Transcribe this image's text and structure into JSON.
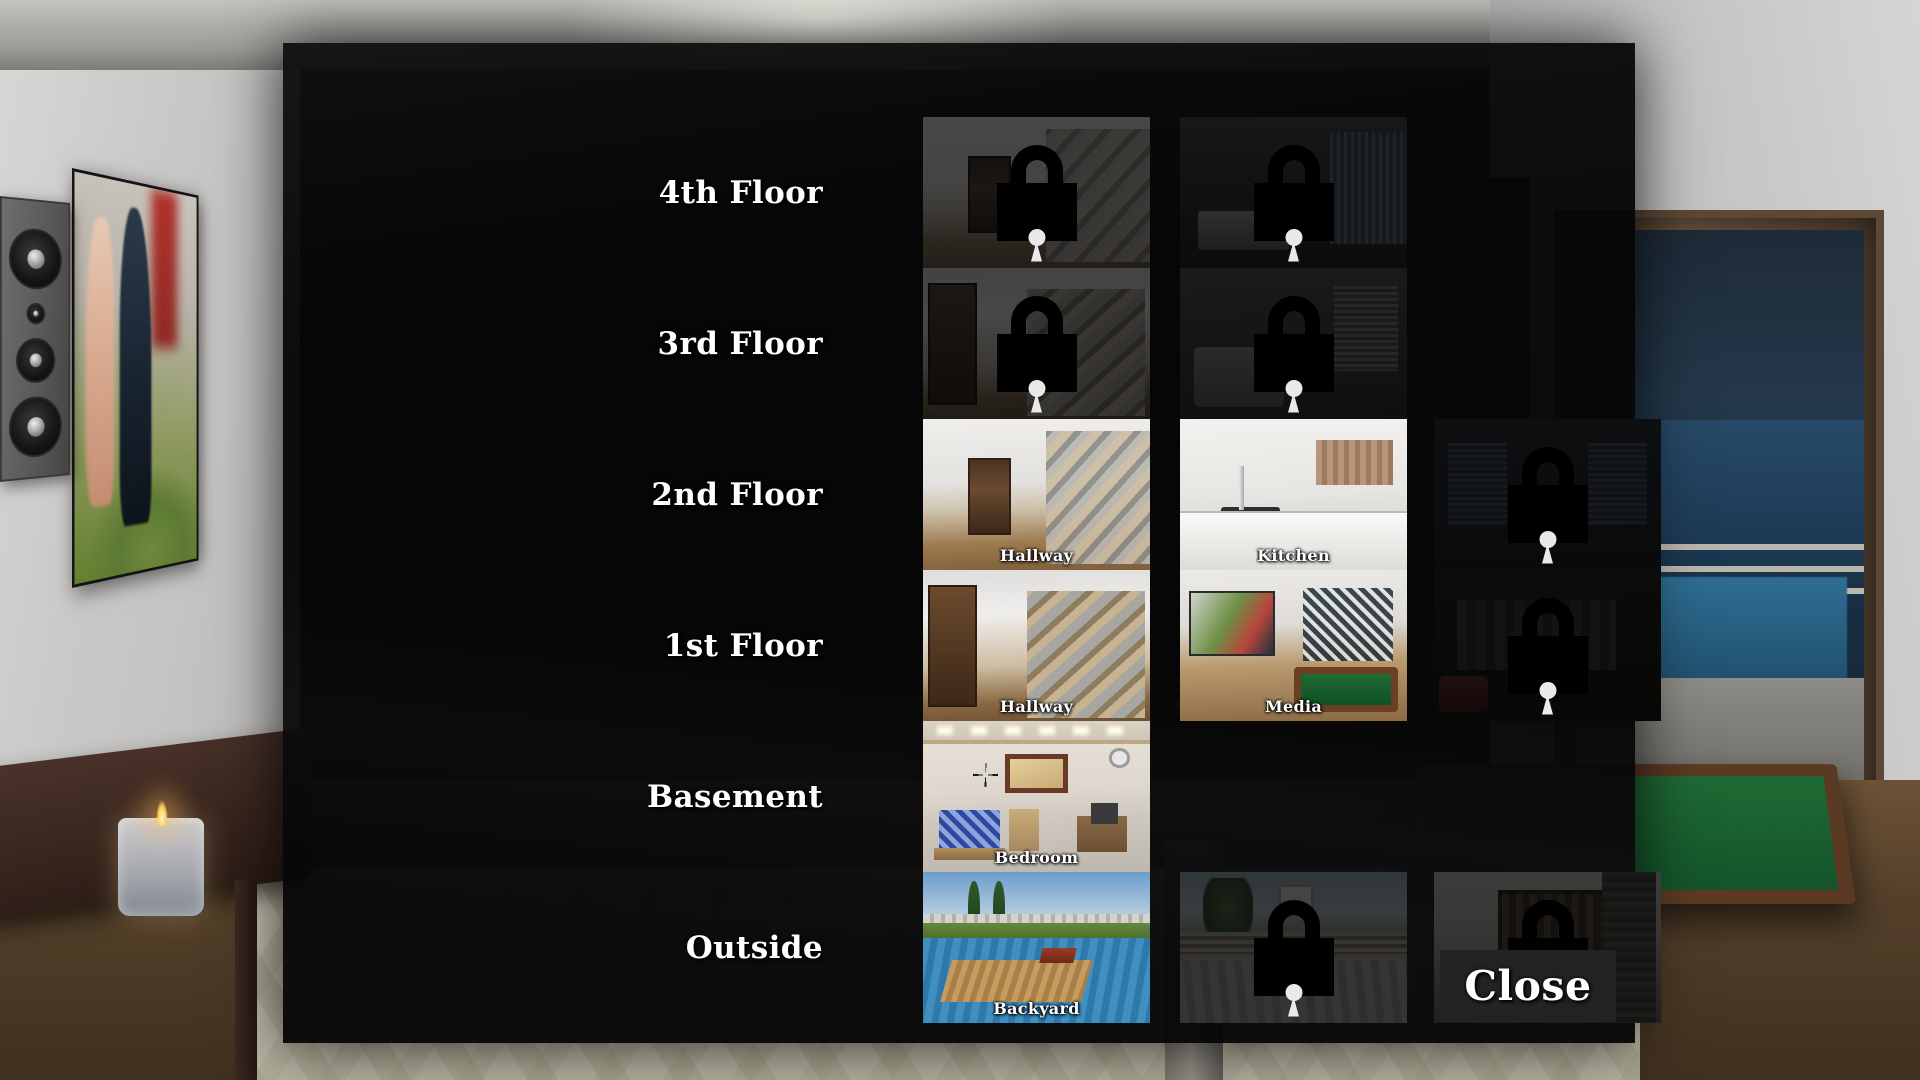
{
  "modal": {
    "close_label": "Close"
  },
  "rows": [
    {
      "floor_label": "4th Floor",
      "thumbs": [
        {
          "room": "",
          "locked": true,
          "art": "art-hallway"
        },
        {
          "room": "",
          "locked": true,
          "art": "art-gym"
        },
        {
          "room": "",
          "locked": true,
          "art": "art-living",
          "empty": true
        }
      ]
    },
    {
      "floor_label": "3rd Floor",
      "thumbs": [
        {
          "room": "",
          "locked": true,
          "art": "art-hallway2"
        },
        {
          "room": "",
          "locked": true,
          "art": "art-living"
        },
        {
          "room": "",
          "locked": true,
          "art": "art-dining",
          "empty": true
        }
      ]
    },
    {
      "floor_label": "2nd Floor",
      "thumbs": [
        {
          "room": "Hallway",
          "locked": false,
          "art": "art-hallway"
        },
        {
          "room": "Kitchen",
          "locked": false,
          "art": "art-kitchen"
        },
        {
          "room": "",
          "locked": true,
          "art": "art-dining"
        }
      ]
    },
    {
      "floor_label": "1st Floor",
      "thumbs": [
        {
          "room": "Hallway",
          "locked": false,
          "art": "art-hallway2"
        },
        {
          "room": "Media",
          "locked": false,
          "art": "art-media"
        },
        {
          "room": "",
          "locked": true,
          "art": "art-garage"
        }
      ]
    },
    {
      "floor_label": "Basement",
      "thumbs": [
        {
          "room": "Bedroom",
          "locked": false,
          "art": "art-bedroom"
        },
        {
          "room": "",
          "locked": false,
          "art": "",
          "empty": true
        },
        {
          "room": "",
          "locked": false,
          "art": "",
          "empty": true
        }
      ]
    },
    {
      "floor_label": "Outside",
      "thumbs": [
        {
          "room": "Backyard",
          "locked": false,
          "art": "art-backyard"
        },
        {
          "room": "",
          "locked": true,
          "art": "art-patio"
        },
        {
          "room": "",
          "locked": true,
          "art": "art-front"
        }
      ]
    }
  ],
  "colors": {
    "modal_background": "#060607",
    "close_button_background": "#232323",
    "label_text": "#ffffff",
    "lock_icon": "#000000"
  },
  "icons": {
    "lock": "lock-icon"
  }
}
